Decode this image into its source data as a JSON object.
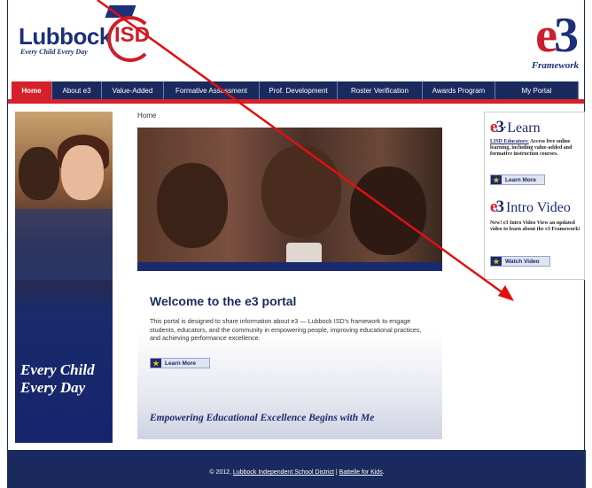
{
  "header": {
    "logo_name": "Lubbock",
    "logo_tagline": "Every Child Every Day",
    "logo_isd": "ISD",
    "e3_logo_e": "e",
    "e3_logo_3": "3",
    "e3_framework": "Framework"
  },
  "nav": {
    "items": [
      {
        "label": "Home",
        "active": true
      },
      {
        "label": "About e3"
      },
      {
        "label": "Value-Added"
      },
      {
        "label": "Formative Assessment"
      },
      {
        "label": "Prof. Development"
      },
      {
        "label": "Roster Verification"
      },
      {
        "label": "Awards Program"
      },
      {
        "label": "My Portal"
      }
    ]
  },
  "left_banner": {
    "line1": "Every Child",
    "line2": "Every Day"
  },
  "main": {
    "breadcrumb": "Home",
    "welcome_title": "Welcome to the e3 portal",
    "welcome_body": "This portal is designed to share information about e3 — Lubbock ISD's framework to engage students, educators, and the community in empowering people, improving educational practices, and achieving performance excellence.",
    "learn_more": "Learn More",
    "tagline": "Empowering Educational Excellence Begins with Me"
  },
  "sidebar": {
    "learn_e": "e",
    "learn_3": "3",
    "learn_title": "·Learn",
    "learn_link": "LISD Educators:",
    "learn_text": " Access free online learning, including value-added and formative instruction courses.",
    "learn_button": "Learn More",
    "video_e": "e",
    "video_3": "3",
    "video_title": " Intro Video",
    "video_text": "New! e3 Intro Video View an updated video to learn about the e3 Framework!",
    "video_button": "Watch Video"
  },
  "footer": {
    "copyright": "© 2012, ",
    "link1": "Lubbock Independent School District",
    "separator": " | ",
    "link2": "Battelle for Kids",
    "end": "."
  },
  "colors": {
    "navy": "#1a2a5e",
    "red": "#d6202c",
    "annotation_arrow": "#e01010"
  }
}
